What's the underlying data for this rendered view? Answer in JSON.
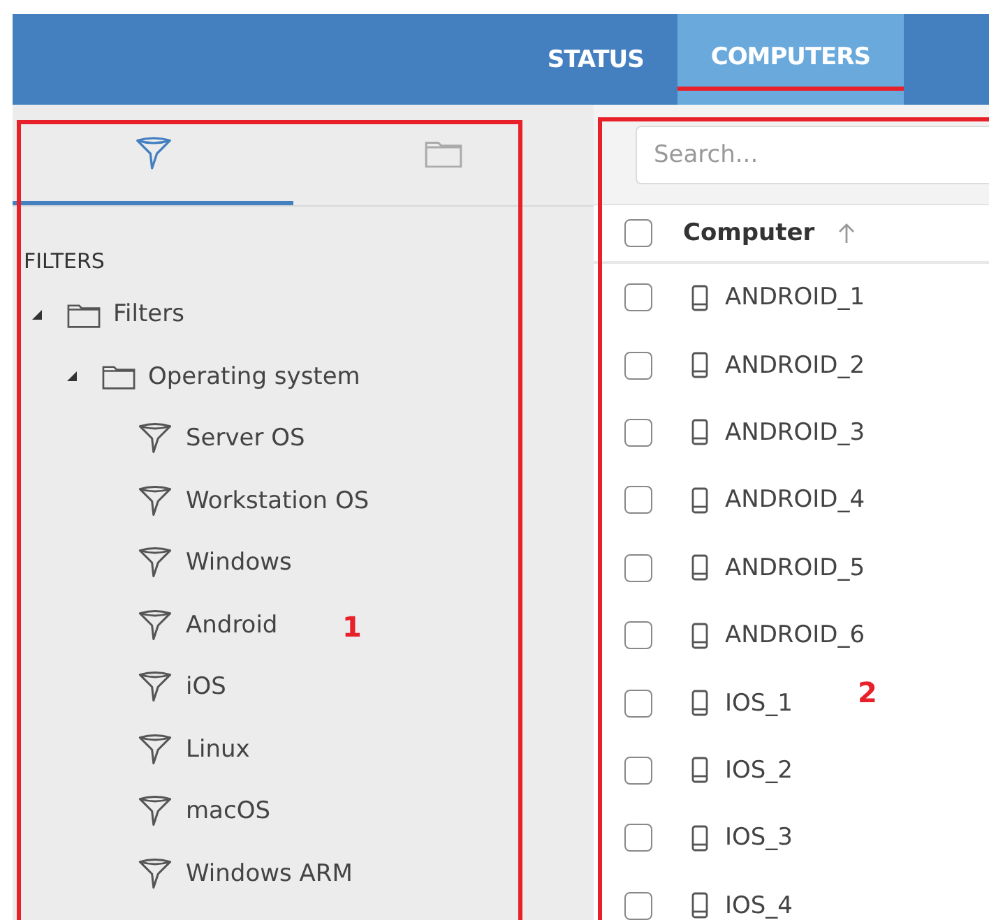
{
  "header": {
    "tabs": [
      {
        "label": "STATUS",
        "selected": false
      },
      {
        "label": "COMPUTERS",
        "selected": true
      }
    ]
  },
  "left_panel": {
    "tabs": [
      {
        "kind": "filter",
        "selected": true
      },
      {
        "kind": "folder",
        "selected": false
      }
    ],
    "heading": "FILTERS",
    "tree": [
      {
        "label": "Filters",
        "kind": "folder",
        "expanded": true,
        "children": [
          {
            "label": "Operating system",
            "kind": "folder",
            "expanded": true,
            "children": [
              {
                "label": "Server OS",
                "kind": "filter"
              },
              {
                "label": "Workstation OS",
                "kind": "filter"
              },
              {
                "label": "Windows",
                "kind": "filter"
              },
              {
                "label": "Android",
                "kind": "filter"
              },
              {
                "label": "iOS",
                "kind": "filter"
              },
              {
                "label": "Linux",
                "kind": "filter"
              },
              {
                "label": "macOS",
                "kind": "filter"
              },
              {
                "label": "Windows ARM",
                "kind": "filter"
              }
            ]
          }
        ]
      }
    ]
  },
  "right_panel": {
    "search": {
      "placeholder": "Search..."
    },
    "table": {
      "all_checked": false,
      "column": {
        "label": "Computer",
        "sort_ascending": true
      },
      "rows": [
        {
          "name": "ANDROID_1",
          "checked": false
        },
        {
          "name": "ANDROID_2",
          "checked": false
        },
        {
          "name": "ANDROID_3",
          "checked": false
        },
        {
          "name": "ANDROID_4",
          "checked": false
        },
        {
          "name": "ANDROID_5",
          "checked": false
        },
        {
          "name": "ANDROID_6",
          "checked": false
        },
        {
          "name": "IOS_1",
          "checked": false
        },
        {
          "name": "IOS_2",
          "checked": false
        },
        {
          "name": "IOS_3",
          "checked": false
        },
        {
          "name": "IOS_4",
          "checked": false
        }
      ]
    }
  },
  "annotations": [
    {
      "label": "1"
    },
    {
      "label": "2"
    }
  ]
}
